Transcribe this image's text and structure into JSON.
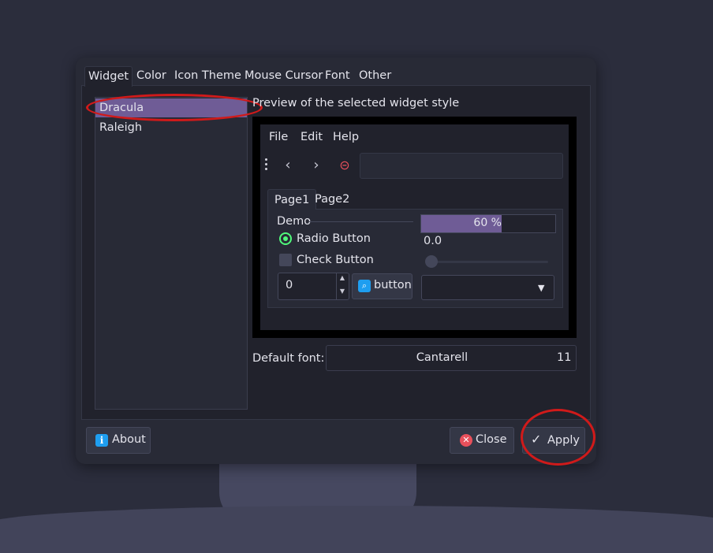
{
  "tabs": [
    "Widget",
    "Color",
    "Icon Theme",
    "Mouse Cursor",
    "Font",
    "Other"
  ],
  "styles": [
    "Dracula",
    "Raleigh"
  ],
  "preview_label": "Preview of the selected widget style",
  "preview": {
    "menu": [
      "File",
      "Edit",
      "Help"
    ],
    "tabs": [
      "Page1",
      "Page2"
    ],
    "group_title": "Demo",
    "radio_label": "Radio Button",
    "check_label": "Check Button",
    "spin_value": "0",
    "button_label": "button",
    "progress_percent": 60,
    "progress_text": "60 %",
    "slider_value": "0.0"
  },
  "font": {
    "label": "Default font:",
    "name": "Cantarell",
    "size": "11"
  },
  "buttons": {
    "about": "About",
    "close": "Close",
    "apply": "Apply"
  },
  "colors": {
    "selection": "#6f5c96",
    "annotation": "#d01a1a",
    "radio_accent": "#50fa7b"
  }
}
